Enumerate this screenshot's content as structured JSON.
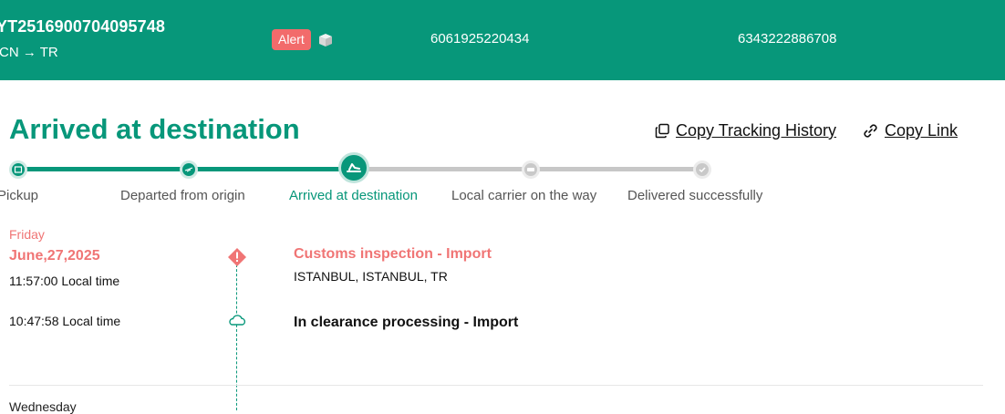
{
  "header": {
    "tracking_number": "YT2516900704095748",
    "route": "CN → TR",
    "alert_label": "Alert",
    "reference_1": "6061925220434",
    "reference_2": "6343222886708"
  },
  "status": {
    "title": "Arrived at destination",
    "copy_history_label": "Copy Tracking History",
    "copy_link_label": "Copy Link"
  },
  "steps": [
    {
      "label": "Pickup",
      "state": "done"
    },
    {
      "label": "Departed from origin",
      "state": "done"
    },
    {
      "label": "Arrived at destination",
      "state": "current"
    },
    {
      "label": "Local carrier on the way",
      "state": "todo"
    },
    {
      "label": "Delivered successfully",
      "state": "todo"
    }
  ],
  "events_group": {
    "day": "Friday",
    "date": "June,27,2025",
    "events": [
      {
        "time": "11:57:00 Local time",
        "title": "Customs inspection - Import",
        "location": "ISTANBUL, ISTANBUL, TR",
        "icon": "alert-icon"
      },
      {
        "time": "10:47:58 Local time",
        "title": "In clearance processing - Import",
        "location": "",
        "icon": "cloud-icon"
      }
    ]
  },
  "next_group_day": "Wednesday",
  "colors": {
    "brand": "#07977a",
    "alert": "#f07575",
    "inactive": "#c7c7c7"
  }
}
